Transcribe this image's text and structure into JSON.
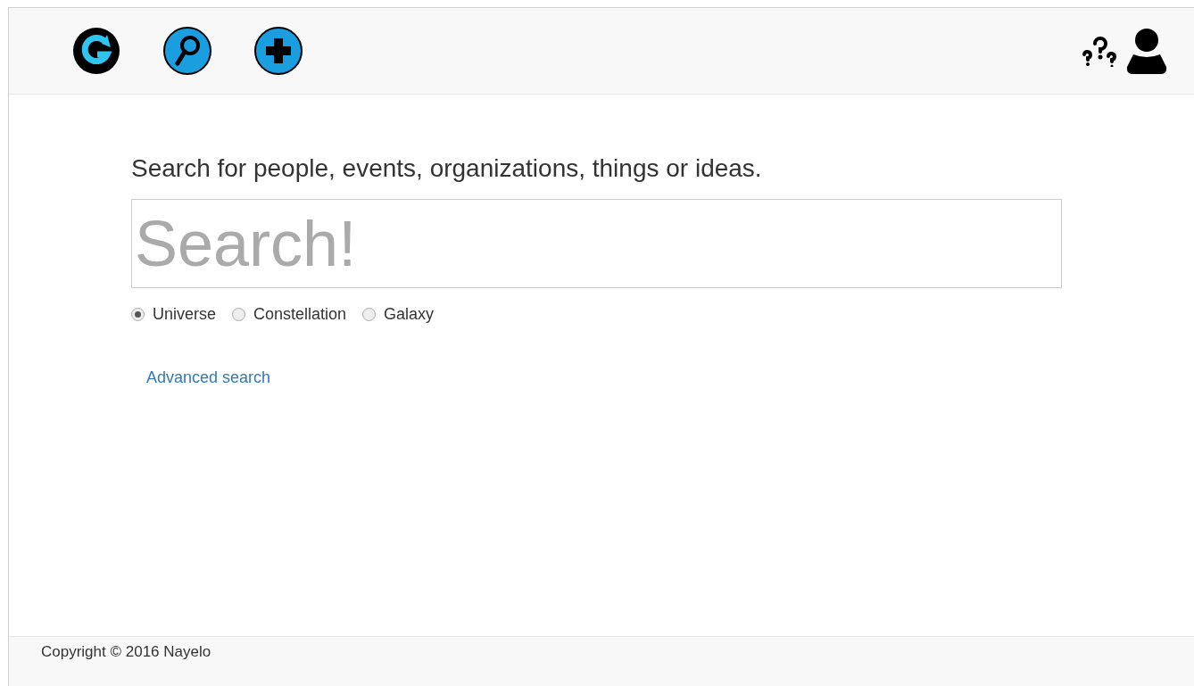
{
  "prompt": "Search for people, events, organizations, things or ideas.",
  "search": {
    "placeholder": "Search!"
  },
  "scopes": [
    {
      "label": "Universe",
      "selected": true
    },
    {
      "label": "Constellation",
      "selected": false
    },
    {
      "label": "Galaxy",
      "selected": false
    }
  ],
  "advanced_link": "Advanced search",
  "footer": "Copyright © 2016 Nayelo"
}
